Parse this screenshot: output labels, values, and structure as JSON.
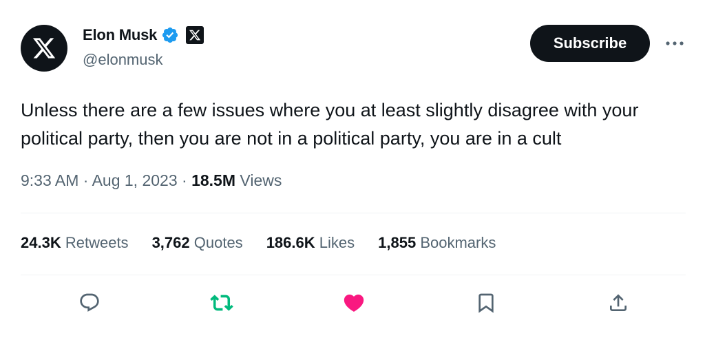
{
  "author": {
    "name": "Elon Musk",
    "handle": "@elonmusk"
  },
  "header": {
    "subscribe_label": "Subscribe"
  },
  "tweet": {
    "text": "Unless there are a few issues where you at least slightly disagree with your political party, then you are not in a political party, you are in a cult",
    "time": "9:33 AM",
    "separator": " · ",
    "date": "Aug 1, 2023",
    "views_count": "18.5M",
    "views_label": "Views"
  },
  "stats": [
    {
      "count": "24.3K",
      "label": "Retweets"
    },
    {
      "count": "3,762",
      "label": "Quotes"
    },
    {
      "count": "186.6K",
      "label": "Likes"
    },
    {
      "count": "1,855",
      "label": "Bookmarks"
    }
  ],
  "icons": {
    "avatar": "x-logo-icon",
    "verified": "verified-badge-icon",
    "affiliation": "x-affiliation-icon",
    "more": "more-icon",
    "reply": "reply-icon",
    "retweet": "retweet-icon",
    "like": "like-icon",
    "bookmark": "bookmark-icon",
    "share": "share-icon"
  },
  "colors": {
    "text": "#0f1419",
    "secondary": "#536471",
    "verified": "#1d9bf0",
    "retweet_active": "#00ba7c",
    "like_active": "#f91880",
    "divider": "#eff3f4"
  },
  "state": {
    "retweeted": true,
    "liked": true
  }
}
